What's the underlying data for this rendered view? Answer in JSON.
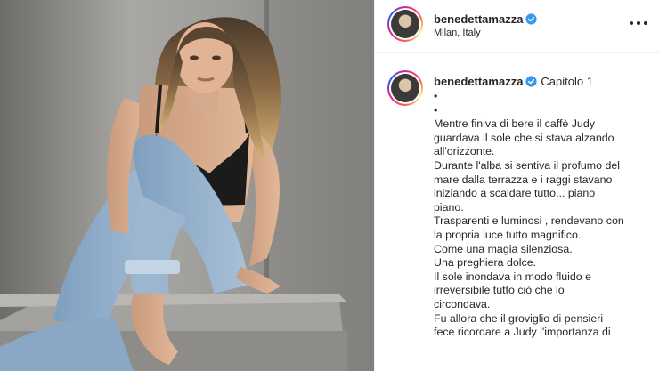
{
  "header": {
    "username": "benedettamazza",
    "location": "Milan, Italy"
  },
  "caption": {
    "username": "benedettamazza",
    "title": "Capitolo 1",
    "lines": [
      "•",
      "•",
      "Mentre finiva di bere il caffè Judy",
      "guardava il sole che si stava alzando",
      "all'orizzonte.",
      "Durante l'alba si sentiva il profumo del",
      "mare dalla terrazza e i raggi stavano",
      "iniziando a scaldare tutto... piano",
      "piano.",
      "Trasparenti e luminosi , rendevano con",
      "la propria luce tutto magnifico.",
      "Come una magia silenziosa.",
      "Una preghiera dolce.",
      "Il sole inondava in modo fluido e",
      "irreversibile tutto ciò che lo",
      "circondava.",
      "Fu allora che il groviglio di pensieri",
      "fece ricordare a Judy l'importanza di"
    ]
  },
  "colors": {
    "verified_blue": "#3897f0",
    "text": "#262626",
    "divider": "#efefef"
  },
  "icons": {
    "verified": "verified-badge-icon",
    "more": "more-options-icon"
  }
}
